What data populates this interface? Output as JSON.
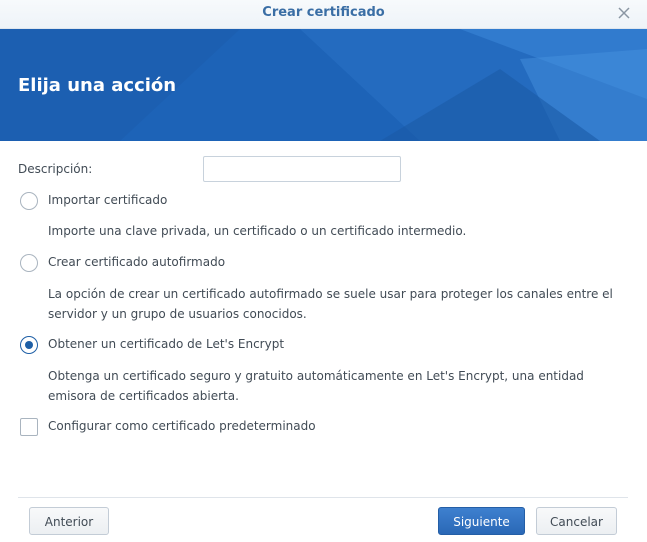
{
  "window": {
    "title": "Crear certificado",
    "close_icon": "close-icon"
  },
  "banner": {
    "heading": "Elija una acción",
    "color": "#1d63b7"
  },
  "form": {
    "description_label": "Descripción:",
    "description_value": "",
    "options": [
      {
        "label": "Importar certificado",
        "description": "Importe una clave privada, un certificado o un certificado intermedio.",
        "selected": false
      },
      {
        "label": "Crear certificado autofirmado",
        "description": "La opción de crear un certificado autofirmado se suele usar para proteger los canales entre el servidor y un grupo de usuarios conocidos.",
        "selected": false
      },
      {
        "label": "Obtener un certificado de Let's Encrypt",
        "description": "Obtenga un certificado seguro y gratuito automáticamente en Let's Encrypt, una entidad emisora de certificados abierta.",
        "selected": true
      }
    ],
    "default_checkbox_label": "Configurar como certificado predeterminado",
    "default_checkbox_checked": false
  },
  "footer": {
    "back_label": "Anterior",
    "next_label": "Siguiente",
    "cancel_label": "Cancelar"
  }
}
